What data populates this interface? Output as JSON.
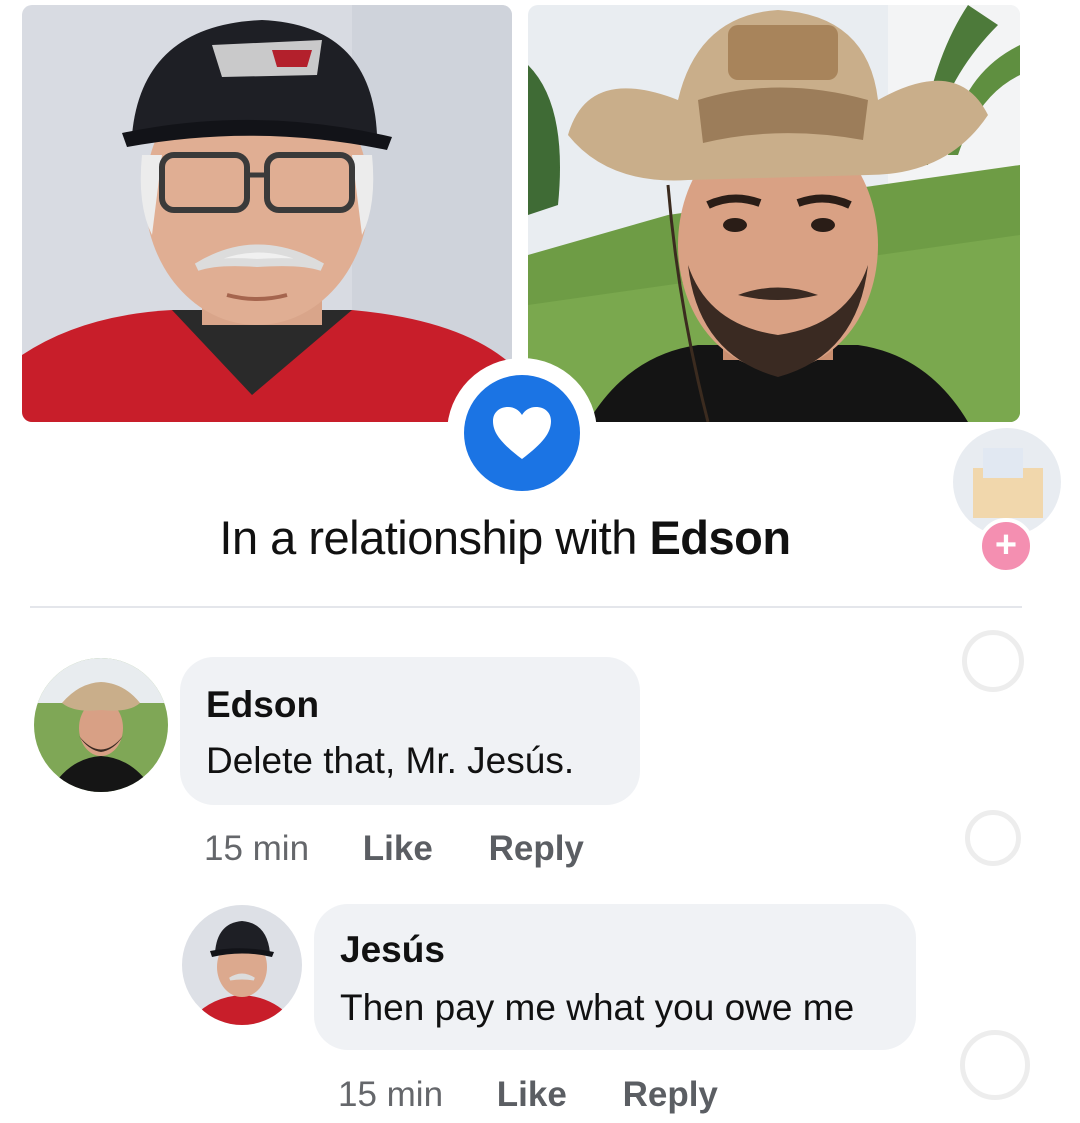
{
  "relationship": {
    "prefix": "In a relationship with ",
    "partner": "Edson"
  },
  "comments": [
    {
      "author": "Edson",
      "text": "Delete that, Mr. Jesús.",
      "time": "15 min",
      "like_label": "Like",
      "reply_label": "Reply"
    },
    {
      "author": "Jesús",
      "text": "Then pay me what you owe me",
      "time": "15 min",
      "like_label": "Like",
      "reply_label": "Reply"
    }
  ],
  "icons": {
    "relationship": "heart-icon",
    "add": "plus-icon"
  },
  "colors": {
    "accent": "#1b74e4",
    "bubble": "#f0f2f5",
    "meta": "#65676b",
    "plus_badge": "#f48fb1"
  }
}
